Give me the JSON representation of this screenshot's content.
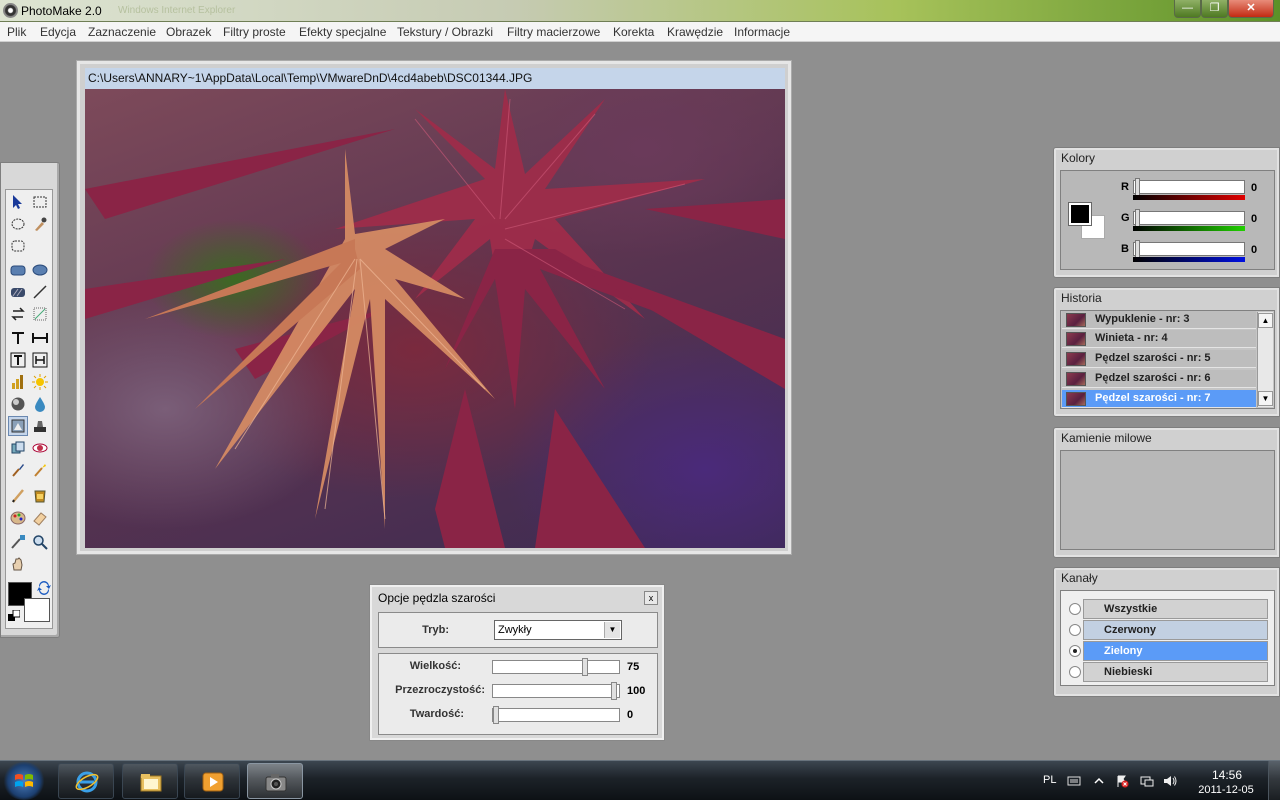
{
  "window": {
    "title": "PhotoMake 2.0",
    "ghost_title": "Windows Internet Explorer",
    "minimize": "—",
    "maximize": "❐",
    "close": "✕"
  },
  "menu": [
    "Plik",
    "Edycja",
    "Zaznaczenie",
    "Obrazek",
    "Filtry proste",
    "Efekty specjalne",
    "Tekstury / Obrazki",
    "Filtry macierzowe",
    "Korekta",
    "Krawędzie",
    "Informacje"
  ],
  "image": {
    "path": "C:\\Users\\ANNARY~1\\AppData\\Local\\Temp\\VMwareDnD\\4cd4abeb\\DSC01344.JPG"
  },
  "options": {
    "title": "Opcje pędzla szarości",
    "close": "x",
    "mode_label": "Tryb:",
    "mode_value": "Zwykły",
    "mode_arrow": "▼",
    "size_label": "Wielkość:",
    "size_value": "75",
    "size": 75,
    "opacity_label": "Przezroczystość:",
    "opacity_value": "100",
    "opacity": 100,
    "hardness_label": "Twardość:",
    "hardness_value": "0",
    "hardness": 0
  },
  "colors": {
    "title": "Kolory",
    "r_label": "R",
    "r_value": "0",
    "g_label": "G",
    "g_value": "0",
    "b_label": "B",
    "b_value": "0",
    "foreground": "#000000",
    "background": "#ffffff"
  },
  "history": {
    "title": "Historia",
    "items": [
      "Wypuklenie - nr: 3",
      "Winieta - nr: 4",
      "Pędzel szarości - nr: 5",
      "Pędzel szarości - nr: 6",
      "Pędzel szarości - nr: 7"
    ],
    "selected_index": 4,
    "scroll_up": "▲",
    "scroll_down": "▼"
  },
  "milestones": {
    "title": "Kamienie milowe"
  },
  "channels": {
    "title": "Kanały",
    "items": [
      "Wszystkie",
      "Czerwony",
      "Zielony",
      "Niebieski"
    ],
    "selected_index": 2
  },
  "taskbar": {
    "language": "PL",
    "time": "14:56",
    "date": "2011-12-05"
  },
  "colors_accent": {
    "selection": "#5b9bf7",
    "title_bar_green": "#5c9128"
  }
}
